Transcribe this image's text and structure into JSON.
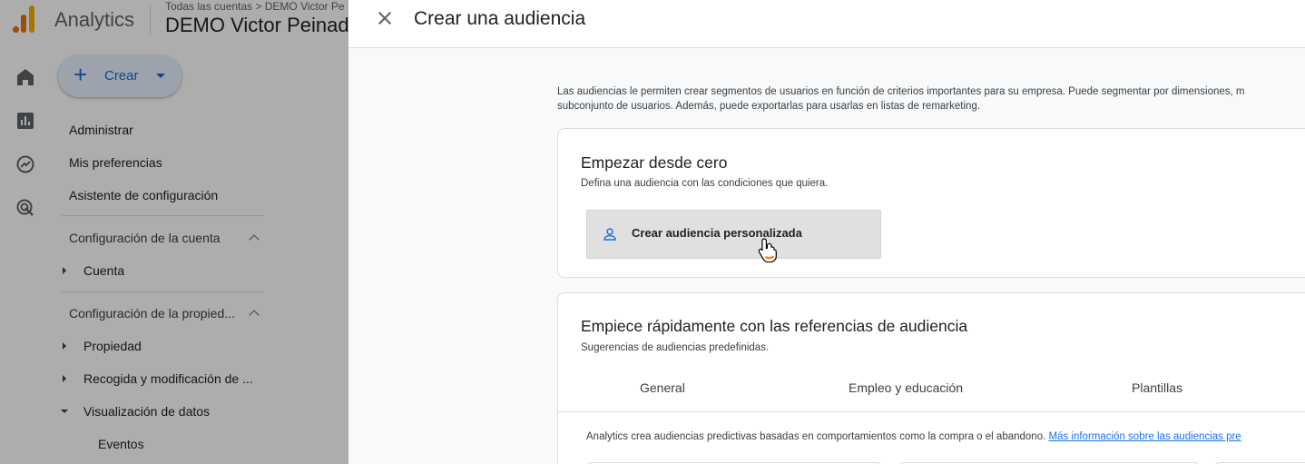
{
  "app": {
    "brand": "Analytics",
    "breadcrumb": "Todas las cuentas > DEMO Victor Pe",
    "account_name": "DEMO Victor Peinad"
  },
  "rail": {
    "icons": [
      "home-icon",
      "reports-icon",
      "explore-icon",
      "advertising-icon"
    ]
  },
  "nav": {
    "create_label": "Crear",
    "items": {
      "admin": "Administrar",
      "preferences": "Mis preferencias",
      "setup_assistant": "Asistente de configuración"
    },
    "account_section": "Configuración de la cuenta",
    "account": "Cuenta",
    "property_section": "Configuración de la propied...",
    "property": "Propiedad",
    "data_collection": "Recogida y modificación de ...",
    "data_display": "Visualización de datos",
    "events": "Eventos"
  },
  "dialog": {
    "title": "Crear una audiencia",
    "intro_line1": "Las audiencias le permiten crear segmentos de usuarios en función de criterios importantes para su empresa. Puede segmentar por dimensiones, m",
    "intro_line2": "subconjunto de usuarios. Además, puede exportarlas para usarlas en listas de remarketing.",
    "scratch": {
      "title": "Empezar desde cero",
      "subtitle": "Defina una audiencia con las condiciones que quiera.",
      "button": "Crear audiencia personalizada"
    },
    "references": {
      "title": "Empiece rápidamente con las referencias de audiencia",
      "subtitle": "Sugerencias de audiencias predefinidas.",
      "tabs": [
        "General",
        "Empleo y educación",
        "Plantillas"
      ],
      "predictive_text": "Analytics crea audiencias predictivas basadas en comportamientos como la compra o el abandono.",
      "predictive_link": "Más información sobre las audiencias pre"
    }
  },
  "colors": {
    "accent": "#1967d2",
    "link": "#1a73e8",
    "scrim": "rgba(0,0,0,0.32)"
  }
}
